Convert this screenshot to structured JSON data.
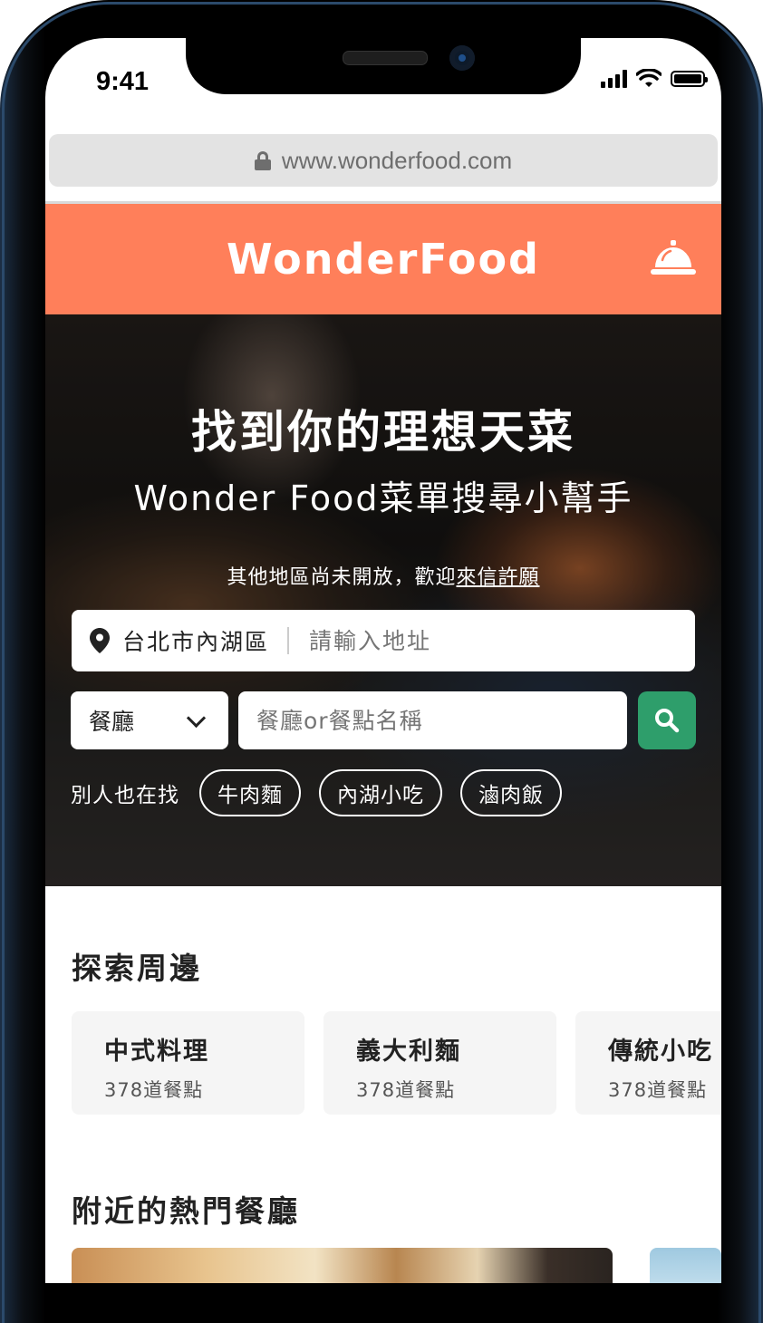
{
  "status_bar": {
    "time": "9:41"
  },
  "browser": {
    "url": "www.wonderfood.com"
  },
  "header": {
    "brand": "WonderFood"
  },
  "hero": {
    "title": "找到你的理想天菜",
    "subtitle": "Wonder Food菜單搜尋小幫手",
    "note_prefix": "其他地區尚未開放，歡迎",
    "note_link": "來信許願"
  },
  "search": {
    "location_city": "台北市內湖區",
    "address_placeholder": "請輸入地址",
    "type_selected": "餐廳",
    "query_placeholder": "餐廳or餐點名稱",
    "trending_label": "別人也在找",
    "trending_tags": [
      "牛肉麵",
      "內湖小吃",
      "滷肉飯"
    ]
  },
  "explore": {
    "title": "探索周邊",
    "categories": [
      {
        "name": "中式料理",
        "count": "378道餐點"
      },
      {
        "name": "義大利麵",
        "count": "378道餐點"
      },
      {
        "name": "傳統小吃",
        "count": "378道餐點"
      }
    ]
  },
  "popular": {
    "title": "附近的熱門餐廳"
  },
  "colors": {
    "brand": "#ff7f5a",
    "search_button": "#2e9e6b"
  },
  "icons": [
    "lock-icon",
    "bell-icon",
    "pin-icon",
    "chevron-down-icon",
    "search-icon",
    "wifi-icon",
    "battery-icon",
    "signal-icon"
  ]
}
